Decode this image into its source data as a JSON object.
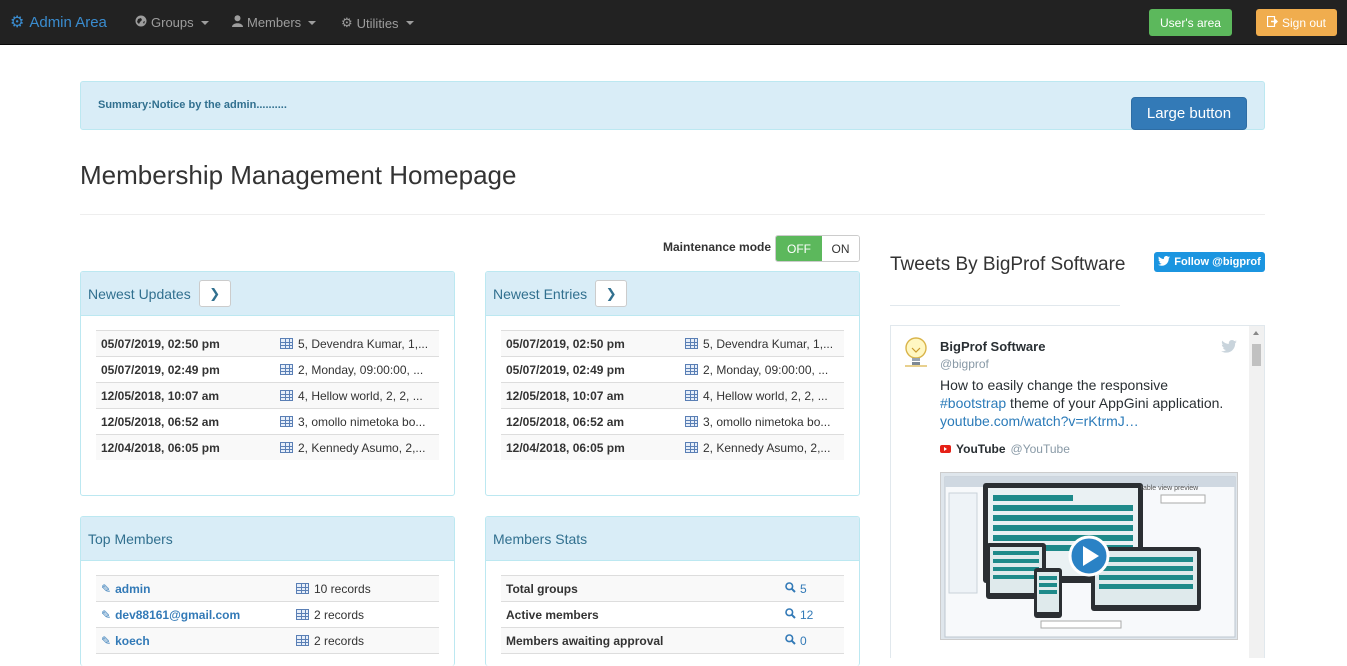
{
  "navbar": {
    "brand": "Admin Area",
    "menus": [
      {
        "label": "Groups",
        "icon": "globe-icon"
      },
      {
        "label": "Members",
        "icon": "user-icon"
      },
      {
        "label": "Utilities",
        "icon": "cog-icon"
      }
    ],
    "users_area": "User's area",
    "sign_out": "Sign out"
  },
  "notice": {
    "text": "Summary:Notice by the admin..........",
    "button": "Large button"
  },
  "page_title": "Membership Management Homepage",
  "maintenance": {
    "label": "Maintenance mode",
    "off": "OFF",
    "on": "ON",
    "active": "OFF"
  },
  "newest_updates": {
    "title": "Newest Updates",
    "rows": [
      {
        "date": "05/07/2019, 02:50 pm",
        "record": "5, Devendra Kumar, 1,..."
      },
      {
        "date": "05/07/2019, 02:49 pm",
        "record": "2, Monday, 09:00:00, ..."
      },
      {
        "date": "12/05/2018, 10:07 am",
        "record": "4, Hellow world, 2, 2, ..."
      },
      {
        "date": "12/05/2018, 06:52 am",
        "record": "3, omollo nimetoka bo..."
      },
      {
        "date": "12/04/2018, 06:05 pm",
        "record": "2, Kennedy Asumo, 2,..."
      }
    ]
  },
  "newest_entries": {
    "title": "Newest Entries",
    "rows": [
      {
        "date": "05/07/2019, 02:50 pm",
        "record": "5, Devendra Kumar, 1,..."
      },
      {
        "date": "05/07/2019, 02:49 pm",
        "record": "2, Monday, 09:00:00, ..."
      },
      {
        "date": "12/05/2018, 10:07 am",
        "record": "4, Hellow world, 2, 2, ..."
      },
      {
        "date": "12/05/2018, 06:52 am",
        "record": "3, omollo nimetoka bo..."
      },
      {
        "date": "12/04/2018, 06:05 pm",
        "record": "2, Kennedy Asumo, 2,..."
      }
    ]
  },
  "top_members": {
    "title": "Top Members",
    "rows": [
      {
        "name": "admin",
        "records": "10 records"
      },
      {
        "name": "dev88161@gmail.com",
        "records": "2 records"
      },
      {
        "name": "koech",
        "records": "2 records"
      }
    ]
  },
  "members_stats": {
    "title": "Members Stats",
    "rows": [
      {
        "label": "Total groups",
        "value": "5"
      },
      {
        "label": "Active members",
        "value": "12"
      },
      {
        "label": "Members awaiting approval",
        "value": "0"
      }
    ]
  },
  "twitter": {
    "title": "Tweets By BigProf Software",
    "follow": "Follow @bigprof",
    "tweet": {
      "name": "BigProf Software",
      "handle": "@bigprof",
      "text_1": "How to easily change the responsive",
      "hashtag": "#bootstrap",
      "text_2": " theme of your AppGini application.",
      "link": "youtube.com/watch?v=rKtrmJ…",
      "card_source": "YouTube",
      "card_handle": "@YouTube",
      "video_caption": "table view preview"
    }
  },
  "colors": {
    "navbar_bg": "#222222",
    "brand": "#3a8ccf",
    "success": "#5cb85c",
    "warning": "#f0ad4e",
    "primary": "#337ab7",
    "info_bg": "#d9edf7",
    "info_border": "#bce8f1",
    "twitter": "#1b95e0"
  }
}
